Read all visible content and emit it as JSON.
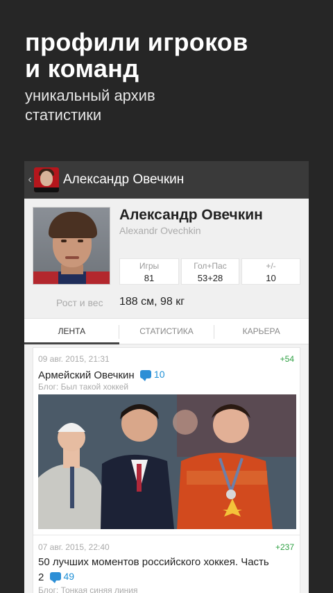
{
  "promo": {
    "title_line1": "профили игроков",
    "title_line2": "и команд",
    "subtitle_line1": "уникальный архив",
    "subtitle_line2": "статистики"
  },
  "appbar": {
    "back_icon": "chevron-left-icon",
    "title": "Александр Овечкин"
  },
  "profile": {
    "name_ru": "Александр Овечкин",
    "name_en": "Alexandr Ovechkin",
    "stats": [
      {
        "label": "Игры",
        "value": "81"
      },
      {
        "label": "Гол+Пас",
        "value": "53+28"
      },
      {
        "label": "+/-",
        "value": "10"
      }
    ],
    "height_weight_label": "Рост и вес",
    "height_weight_value": "188 см, 98 кг"
  },
  "tabs": [
    {
      "label": "ЛЕНТА",
      "active": true
    },
    {
      "label": "СТАТИСТИКА",
      "active": false
    },
    {
      "label": "КАРЬЕРА",
      "active": false
    }
  ],
  "feed": [
    {
      "date": "09 авг. 2015, 21:31",
      "score": "+54",
      "title": "Армейский Овечкин",
      "comments": "10",
      "blog": "Блог: Был такой хоккей"
    },
    {
      "date": "07 авг. 2015, 22:40",
      "score": "+237",
      "title_line1": "50 лучших моментов российского хоккея. Часть",
      "title_line2": "2",
      "comments": "49",
      "blog": "Блог: Тонкая синяя линия"
    }
  ],
  "colors": {
    "background": "#262626",
    "appbar": "#3a3a3a",
    "score_green": "#2ea043",
    "comment_blue": "#1d8fd6"
  }
}
